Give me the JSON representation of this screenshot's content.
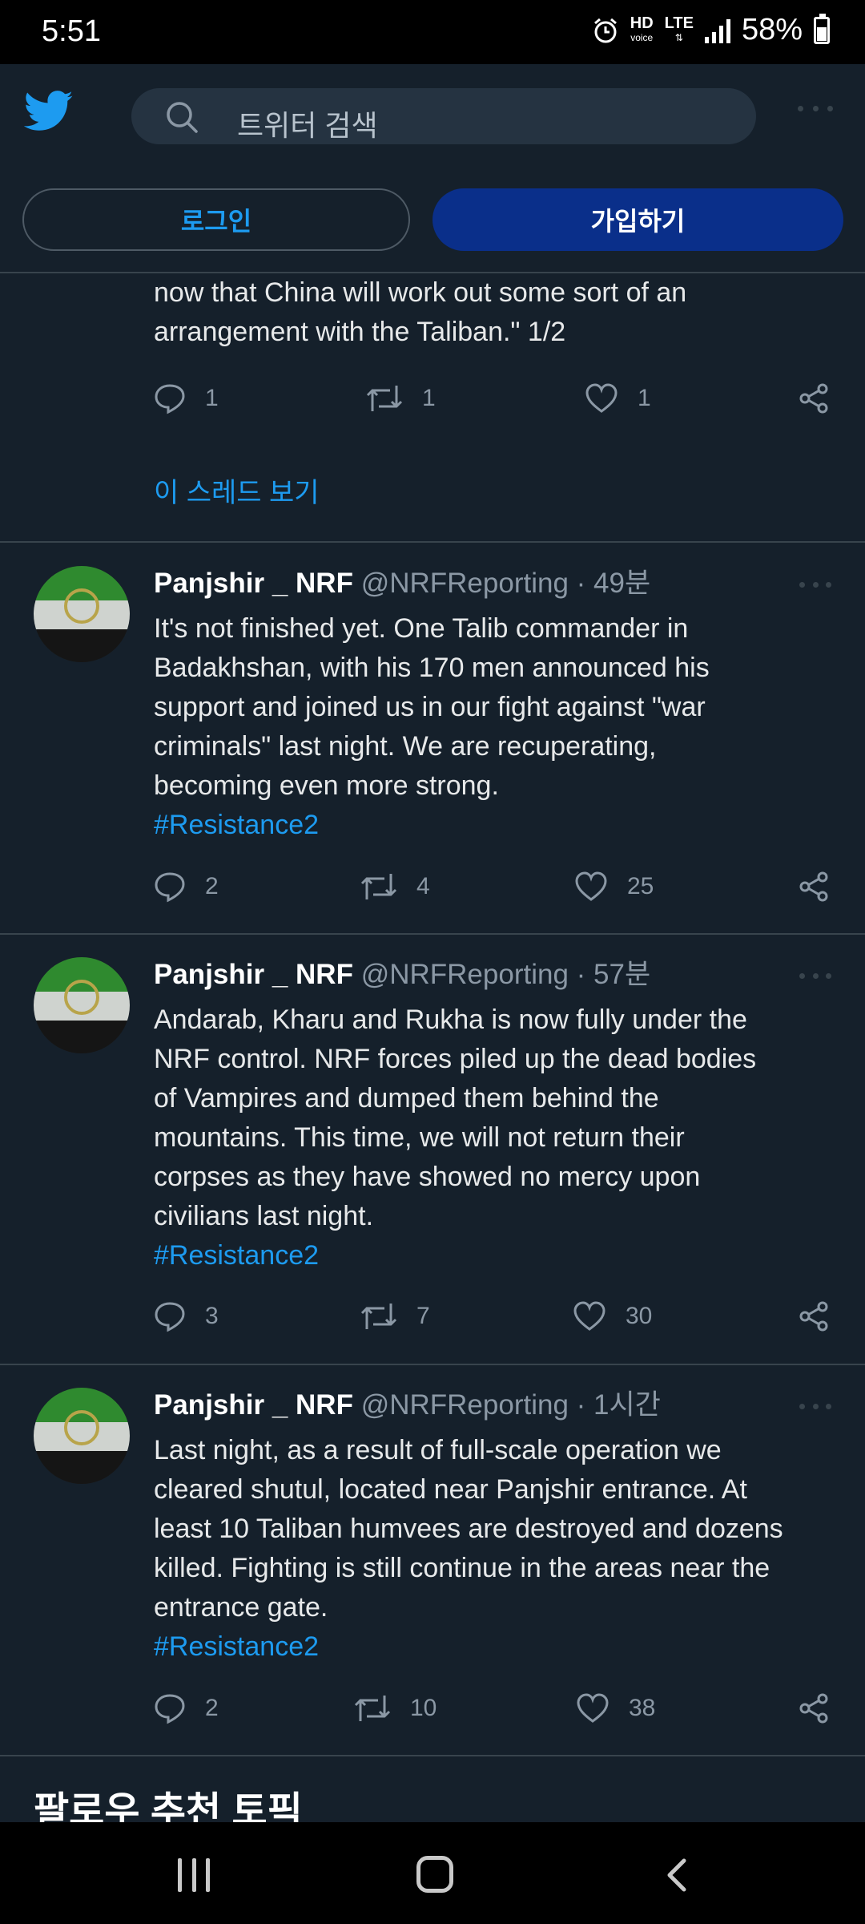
{
  "status_bar": {
    "time": "5:51",
    "hd_label": "HD",
    "hd_sub": "voice",
    "lte_label": "LTE",
    "battery": "58%"
  },
  "header": {
    "search_placeholder": "트위터 검색",
    "login_label": "로그인",
    "signup_label": "가입하기"
  },
  "colors": {
    "background": "#15202b",
    "accent": "#1d9bf0",
    "signup_button": "#0a2f8a",
    "divider": "#38444d",
    "muted_text": "#8b98a5"
  },
  "continued_tweet": {
    "text_lines": [
      "now that China will work out some sort of an",
      "arrangement with the Taliban.\" 1/2"
    ],
    "replies": "1",
    "retweets": "1",
    "likes": "1",
    "thread_link": "이 스레드 보기"
  },
  "tweets": [
    {
      "name": "Panjshir _ NRF",
      "handle": "@NRFReporting",
      "time": " · 49분",
      "lines": [
        "It's not finished yet. One Talib commander in",
        "Badakhshan, with his 170 men announced his",
        "support  and joined us in our fight against \"war",
        "criminals\" last night. We are recuperating,",
        "becoming even more strong."
      ],
      "hashtag": "#Resistance2",
      "replies": "2",
      "retweets": "4",
      "likes": "25"
    },
    {
      "name": "Panjshir _ NRF",
      "handle": "@NRFReporting",
      "time": " · 57분",
      "lines": [
        "Andarab, Kharu and Rukha is now fully under the",
        "NRF control. NRF forces piled up the dead bodies",
        "of Vampires and dumped them behind the",
        "mountains. This time, we will not return their",
        "corpses as they have showed no mercy upon",
        "civilians last night."
      ],
      "hashtag": "#Resistance2",
      "replies": "3",
      "retweets": "7",
      "likes": "30"
    },
    {
      "name": "Panjshir _ NRF",
      "handle": "@NRFReporting",
      "time": " · 1시간",
      "lines": [
        "Last night, as a result of full-scale operation we",
        "cleared shutul, located near Panjshir entrance. At",
        "least 10 Taliban humvees are destroyed and dozens",
        "killed. Fighting is still continue in the areas near the",
        "entrance gate."
      ],
      "hashtag": "#Resistance2",
      "replies": "2",
      "retweets": "10",
      "likes": "38"
    }
  ],
  "topics_heading": "팔로우 추천 토픽",
  "icons": {
    "logo": "twitter-bird-icon",
    "search": "search-icon",
    "reply": "reply-icon",
    "retweet": "retweet-icon",
    "like": "heart-icon",
    "share": "share-icon",
    "more": "more-icon",
    "nav_recent": "recent-apps-icon",
    "nav_home": "home-icon",
    "nav_back": "back-icon"
  }
}
